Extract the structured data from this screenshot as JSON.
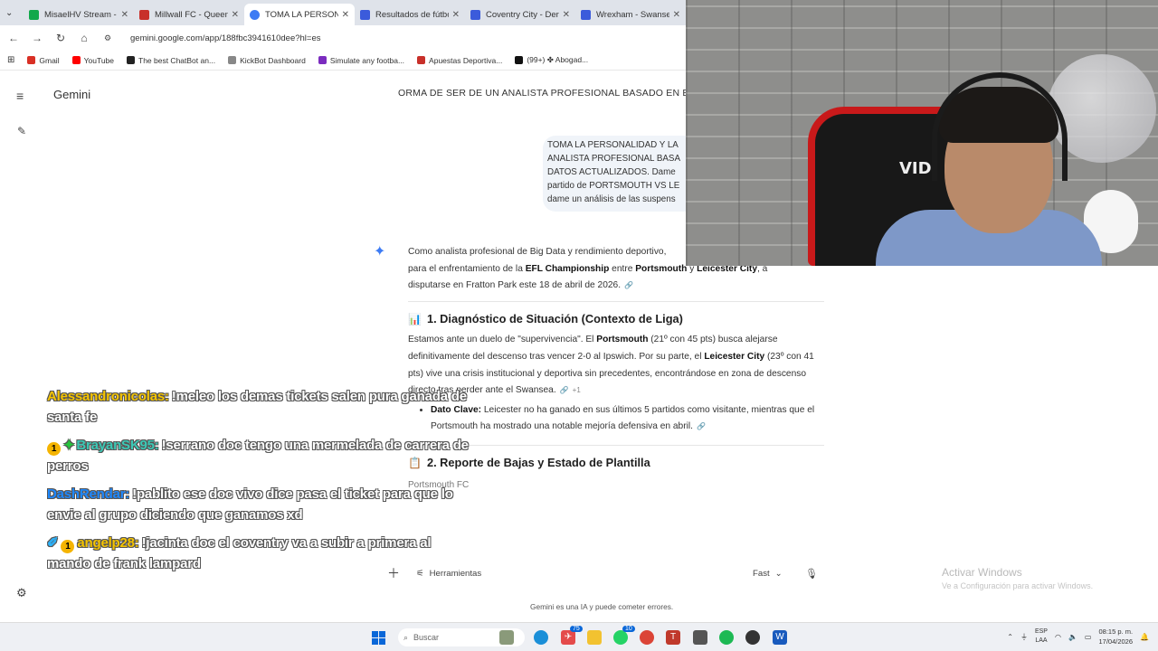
{
  "browser": {
    "tabs": [
      {
        "title": "MisaelHV Stream - W",
        "color": "#11a84a",
        "active": false
      },
      {
        "title": "Millwall FC - Queens",
        "color": "#c8302a",
        "active": false
      },
      {
        "title": "TOMA LA PERSONAL",
        "color": "#3d7bf4",
        "active": true
      },
      {
        "title": "Resultados de fútbol",
        "color": "#3b5bdb",
        "active": false
      },
      {
        "title": "Coventry City - Derb",
        "color": "#3b5bdb",
        "active": false
      },
      {
        "title": "Wrexham - Swansea",
        "color": "#3b5bdb",
        "active": false
      }
    ],
    "url": "gemini.google.com/app/188fbc3941610dee?hl=es",
    "bookmarks": [
      {
        "label": "Gmail",
        "color": "#d93025"
      },
      {
        "label": "YouTube",
        "color": "#ff0000"
      },
      {
        "label": "The best ChatBot an...",
        "color": "#222222"
      },
      {
        "label": "KickBot Dashboard",
        "color": "#888888"
      },
      {
        "label": "Simulate any footba...",
        "color": "#7b2cbf"
      },
      {
        "label": "Apuestas Deportiva...",
        "color": "#c8302a"
      },
      {
        "label": "(99+) ✤ Abogad...",
        "color": "#111111"
      }
    ]
  },
  "app": {
    "title": "Gemini",
    "conversation_title": "ORMA DE SER DE UN ANALISTA PROFESIONAL BASADO EN EST"
  },
  "user_prompt": {
    "lines": [
      "TOMA LA PERSONALIDAD Y LA",
      "ANALISTA PROFESIONAL BASA",
      "DATOS ACTUALIZADOS. Dame",
      "partido de PORTSMOUTH VS LE",
      "dame un análisis de las suspens"
    ]
  },
  "answer": {
    "intro_1": "Como analista profesional de Big Data y rendimiento deportivo,",
    "intro_2a": "para el enfrentamiento de la ",
    "intro_2b": "EFL Championship",
    "intro_2c": " entre ",
    "intro_2d": "Portsmouth",
    "intro_2e": " y ",
    "intro_2f": "Leicester City",
    "intro_2g": ", a",
    "intro_3": "disputarse en Fratton Park este 18 de abril de 2026.",
    "section1_emoji": "📊",
    "section1_title": "1. Diagnóstico de Situación (Contexto de Liga)",
    "s1_p_a": "Estamos ante un duelo de \"supervivencia\". El ",
    "s1_p_b": "Portsmouth",
    "s1_p_c": " (21º con 45 pts) busca alejarse definitivamente del descenso tras vencer 2-0 al Ipswich. Por su parte, el ",
    "s1_p_d": "Leicester City",
    "s1_p_e": " (23º con 41 pts) vive una crisis institucional y deportiva sin precedentes, encontrándose en zona de descenso directo tras perder ante el Swansea.",
    "s1_cite": "+1",
    "bullet_label": "Dato Clave:",
    "bullet_text": " Leicester no ha ganado en sus últimos 5 partidos como visitante, mientras que el Portsmouth ha mostrado una notable mejoría defensiva en abril.",
    "section2_emoji": "📋",
    "section2_title": "2. Reporte de Bajas y Estado de Plantilla",
    "section2_sub": "Portsmouth FC"
  },
  "prompt_bar": {
    "tools_label": "Herramientas",
    "mode_label": "Fast",
    "disclaimer": "Gemini es una IA y puede cometer errores."
  },
  "stream_chat": [
    {
      "user": "Alessandronicolas:",
      "user_color": "#f5c400",
      "badges": "",
      "message": "!meleo los demas tickets salen pura ganada de santa fe"
    },
    {
      "user": "BrayanSK95:",
      "user_color": "#3cc9b6",
      "badges": "1+",
      "message": "!serrano doc tengo una mermelada de carrera de perros"
    },
    {
      "user": "DashRendar:",
      "user_color": "#1e88ff",
      "badges": "",
      "message": "!pablito ese doc vivo dice pasa el ticket para que lo envie al grupo diciendo que ganamos xd"
    },
    {
      "user": "angelp28:",
      "user_color": "#f5c400",
      "badges": "wand1",
      "message": "!jacinta doc el coventry va a subir a primera al mando de frank lampard"
    }
  ],
  "webcam": {
    "chair_text": "VID"
  },
  "watermark": {
    "line1": "Activar Windows",
    "line2": "Ve a Configuración para activar Windows."
  },
  "taskbar": {
    "search_placeholder": "Buscar",
    "lang_top": "ESP",
    "lang_bottom": "LAA",
    "time": "08:15 p. m.",
    "date": "17/04/2026",
    "telegram_badge": "75",
    "whatsapp_badge": "10"
  }
}
